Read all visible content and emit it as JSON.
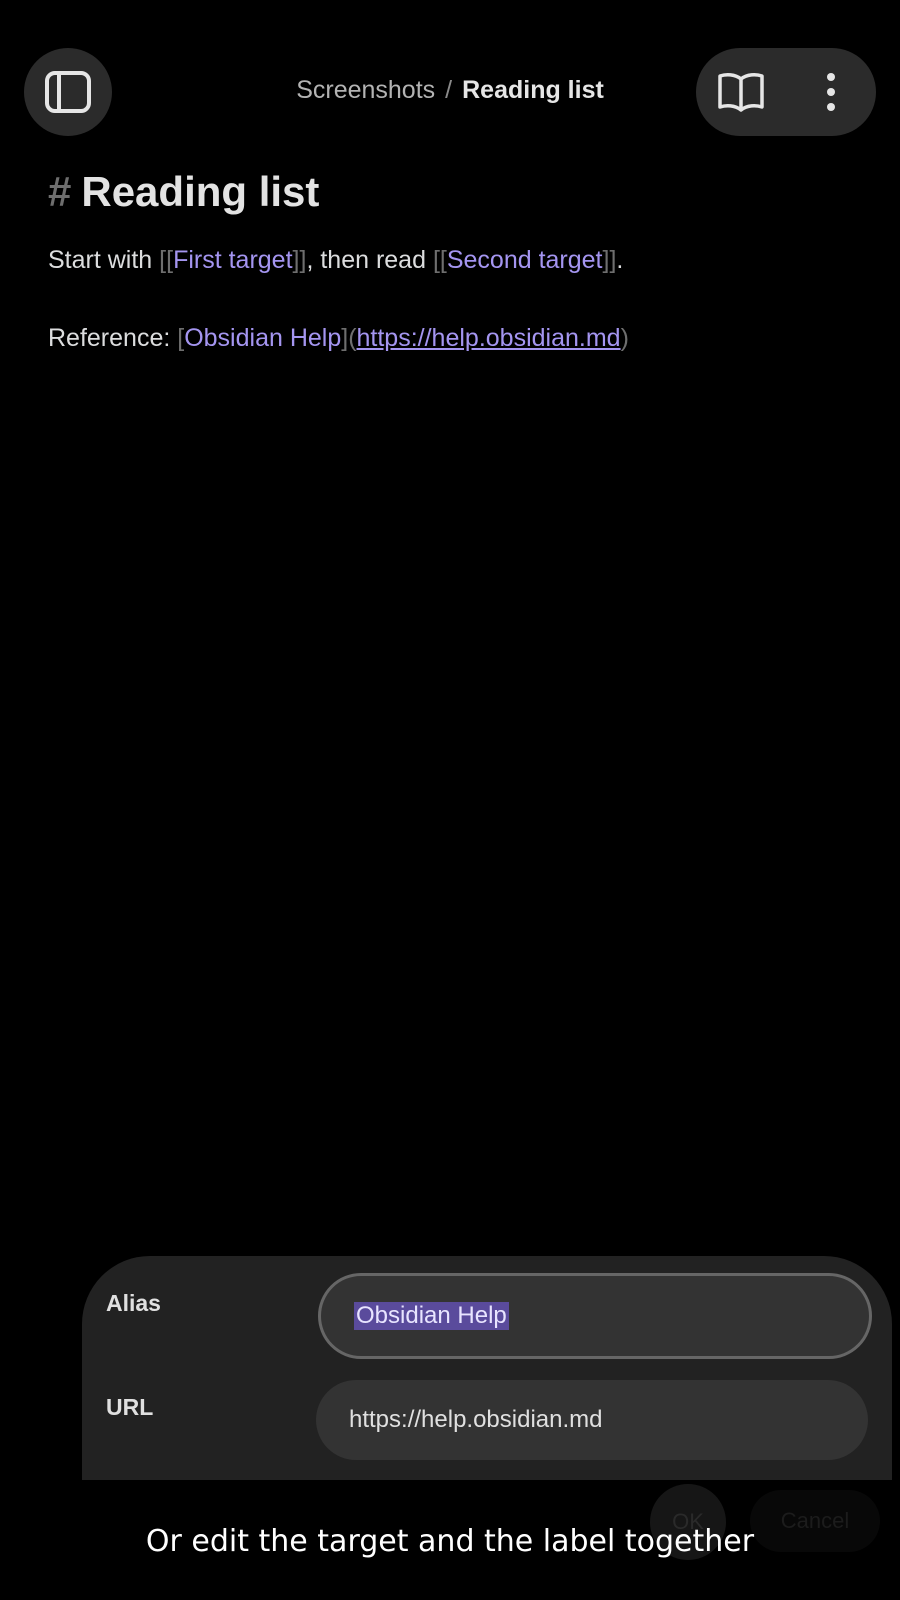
{
  "header": {
    "breadcrumb_parent": "Screenshots",
    "breadcrumb_separator": "/",
    "breadcrumb_current": "Reading list",
    "sidebar_toggle_icon": "sidebar-toggle-icon",
    "reading_mode_icon": "book-open-icon",
    "more_options_icon": "more-vertical-icon"
  },
  "note": {
    "heading_marker": "#",
    "heading": "Reading list",
    "line1": {
      "prefix": "Start with ",
      "link1_open": "[[",
      "link1_text": "First target",
      "link1_close": "]]",
      "middle": ", then read ",
      "link2_open": "[[",
      "link2_text": "Second target",
      "link2_close": "]]",
      "suffix": "."
    },
    "line2": {
      "prefix": "Reference: ",
      "bracket_open": "[",
      "link_text": "Obsidian Help",
      "bracket_close": "]",
      "paren_open": "(",
      "url": "https://help.obsidian.md",
      "paren_close": ")"
    }
  },
  "dialog": {
    "alias_label": "Alias",
    "alias_value": "Obsidian Help",
    "url_label": "URL",
    "url_value": "https://help.obsidian.md",
    "ok_label": "OK",
    "cancel_label": "Cancel"
  },
  "caption": "Or edit the target and the label together",
  "colors": {
    "background": "#000000",
    "accent_link": "#a495f0",
    "selection": "#5a4b9c",
    "sheet": "#222222",
    "input": "#333333"
  }
}
